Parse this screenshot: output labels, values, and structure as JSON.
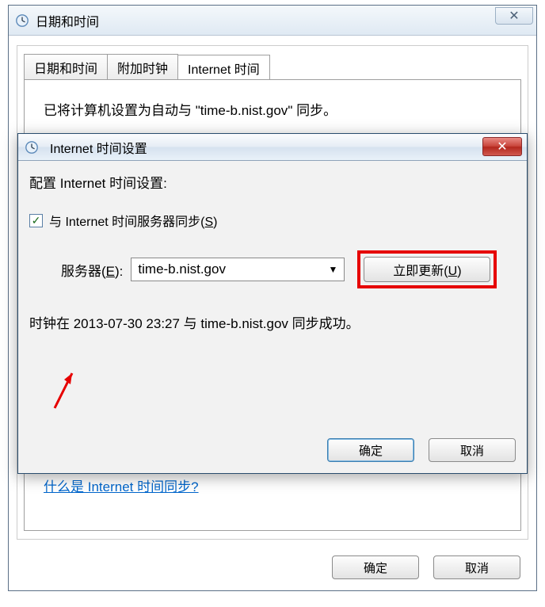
{
  "main": {
    "title": "日期和时间",
    "close_glyph": "✕",
    "tabs": [
      {
        "label": "日期和时间"
      },
      {
        "label": "附加时钟"
      },
      {
        "label": "Internet 时间"
      }
    ],
    "active_tab": 2,
    "sync_info_pre": "已将计算机设置为自动与 \"",
    "sync_info_server": "time-b.nist.gov",
    "sync_info_post": "\" 同步。",
    "link": "什么是 Internet 时间同步?",
    "ok": "确定",
    "cancel": "取消"
  },
  "settings": {
    "title": "Internet 时间设置",
    "close_glyph": "✕",
    "config_label": "配置 Internet 时间设置:",
    "checkbox_checked": true,
    "checkbox_label_pre": "与 Internet 时间服务器同步(",
    "checkbox_hotkey": "S",
    "checkbox_label_post": ")",
    "server_label_pre": "服务器(",
    "server_hotkey": "E",
    "server_label_post": "):",
    "server_value": "time-b.nist.gov",
    "update_label_pre": "立即更新(",
    "update_hotkey": "U",
    "update_label_post": ")",
    "status": "时钟在 2013-07-30 23:27 与 time-b.nist.gov 同步成功。",
    "ok": "确定",
    "cancel": "取消"
  }
}
